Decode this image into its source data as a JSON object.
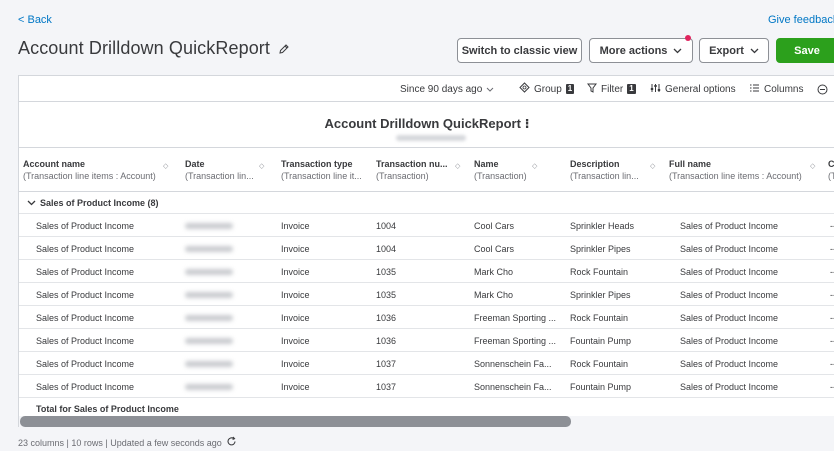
{
  "nav": {
    "back_label": "< Back",
    "feedback_label": "Give feedback"
  },
  "page": {
    "title": "Account Drilldown QuickReport"
  },
  "actions": {
    "classic_label": "Switch to classic view",
    "more_actions_label": "More actions",
    "export_label": "Export",
    "save_label": "Save"
  },
  "toolbar": {
    "date_range": "Since 90 days ago",
    "group_label": "Group",
    "group_count": "1",
    "filter_label": "Filter",
    "filter_count": "1",
    "general_options_label": "General options",
    "columns_label": "Columns"
  },
  "report": {
    "title": "Account Drilldown QuickReport",
    "title_icon": "⁝"
  },
  "columns": [
    {
      "name": "Account name",
      "sub": "(Transaction line items : Account)"
    },
    {
      "name": "Date",
      "sub": "(Transaction lin..."
    },
    {
      "name": "Transaction type",
      "sub": "(Transaction line it..."
    },
    {
      "name": "Transaction nu...",
      "sub": "(Transaction)"
    },
    {
      "name": "Name",
      "sub": "(Transaction)"
    },
    {
      "name": "Description",
      "sub": "(Transaction lin..."
    },
    {
      "name": "Full name",
      "sub": "(Transaction line items : Account)"
    },
    {
      "name": "C",
      "sub": "(T"
    }
  ],
  "group": {
    "label": "Sales of Product Income (8)"
  },
  "rows": [
    {
      "account": "Sales of Product Income",
      "type": "Invoice",
      "number": "1004",
      "name": "Cool Cars",
      "description": "Sprinkler Heads",
      "full_name": "Sales of Product Income",
      "extra": "--"
    },
    {
      "account": "Sales of Product Income",
      "type": "Invoice",
      "number": "1004",
      "name": "Cool Cars",
      "description": "Sprinkler Pipes",
      "full_name": "Sales of Product Income",
      "extra": "--"
    },
    {
      "account": "Sales of Product Income",
      "type": "Invoice",
      "number": "1035",
      "name": "Mark Cho",
      "description": "Rock Fountain",
      "full_name": "Sales of Product Income",
      "extra": "--"
    },
    {
      "account": "Sales of Product Income",
      "type": "Invoice",
      "number": "1035",
      "name": "Mark Cho",
      "description": "Sprinkler Pipes",
      "full_name": "Sales of Product Income",
      "extra": "--"
    },
    {
      "account": "Sales of Product Income",
      "type": "Invoice",
      "number": "1036",
      "name": "Freeman Sporting ...",
      "description": "Rock Fountain",
      "full_name": "Sales of Product Income",
      "extra": "--"
    },
    {
      "account": "Sales of Product Income",
      "type": "Invoice",
      "number": "1036",
      "name": "Freeman Sporting ...",
      "description": "Fountain Pump",
      "full_name": "Sales of Product Income",
      "extra": "--"
    },
    {
      "account": "Sales of Product Income",
      "type": "Invoice",
      "number": "1037",
      "name": "Sonnenschein Fa...",
      "description": "Rock Fountain",
      "full_name": "Sales of Product Income",
      "extra": "--"
    },
    {
      "account": "Sales of Product Income",
      "type": "Invoice",
      "number": "1037",
      "name": "Sonnenschein Fa...",
      "description": "Fountain Pump",
      "full_name": "Sales of Product Income",
      "extra": "--"
    }
  ],
  "total": {
    "label": "Total for Sales of Product Income"
  },
  "status": {
    "text": "23 columns | 10 rows | Updated a few seconds ago"
  },
  "colors": {
    "accent_link": "#0077c5",
    "save_green": "#2ca01c",
    "badge_red": "#e0245e"
  }
}
